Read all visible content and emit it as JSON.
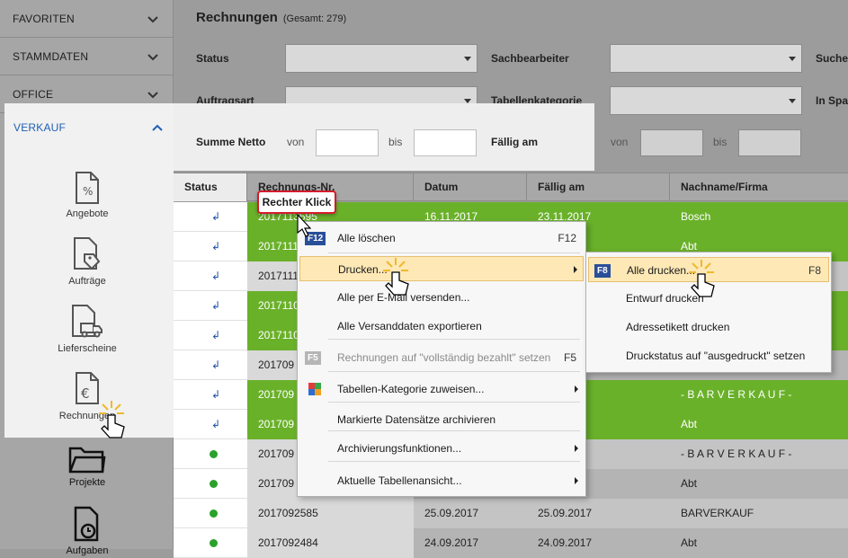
{
  "sidebar": {
    "sections": [
      "FAVORITEN",
      "STAMMDATEN",
      "OFFICE"
    ],
    "active_section": "VERKAUF",
    "items": [
      {
        "label": "Angebote",
        "icon": "offer-document-icon"
      },
      {
        "label": "Aufträge",
        "icon": "order-tag-icon"
      },
      {
        "label": "Lieferscheine",
        "icon": "delivery-truck-icon"
      },
      {
        "label": "Rechnungen",
        "icon": "invoice-euro-icon"
      },
      {
        "label": "Projekte",
        "icon": "project-folder-icon"
      },
      {
        "label": "Aufgaben",
        "icon": "task-clock-icon"
      }
    ]
  },
  "header": {
    "title": "Rechnungen",
    "count": "(Gesamt: 279)"
  },
  "filters": {
    "status": "Status",
    "sachbearbeiter": "Sachbearbeiter",
    "suche": "Suche",
    "auftragsart": "Auftragsart",
    "tabellenkategorie": "Tabellenkategorie",
    "inspa": "In Spa",
    "summe_netto": "Summe Netto",
    "von": "von",
    "bis": "bis",
    "faellig_am": "Fällig am"
  },
  "table": {
    "columns": [
      "Status",
      "Rechnungs-Nr.",
      "Datum",
      "Fällig am",
      "Nachname/Firma"
    ],
    "rows": [
      {
        "status": "return",
        "nr": "2017113595",
        "datum": "16.11.2017",
        "faellig": "23.11.2017",
        "name": "Bosch",
        "green": true
      },
      {
        "status": "return",
        "nr": "2017111",
        "datum": "",
        "faellig": "",
        "name": "Abt",
        "green": true
      },
      {
        "status": "return",
        "nr": "2017111",
        "datum": "",
        "faellig": "",
        "name": "",
        "green": false
      },
      {
        "status": "return",
        "nr": "2017110",
        "datum": "",
        "faellig": "",
        "name": "",
        "green": true
      },
      {
        "status": "return",
        "nr": "2017110",
        "datum": "",
        "faellig": "",
        "name": "",
        "green": true
      },
      {
        "status": "return",
        "nr": "201709",
        "datum": "",
        "faellig": "",
        "name": "",
        "green": false
      },
      {
        "status": "return",
        "nr": "201709",
        "datum": "",
        "faellig": "",
        "name": "- B A R V E R K A U F -",
        "green": true
      },
      {
        "status": "return",
        "nr": "201709",
        "datum": "",
        "faellig": "",
        "name": "Abt",
        "green": true
      },
      {
        "status": "paid",
        "nr": "201709",
        "datum": "",
        "faellig": "",
        "name": "- B A R V E R K A U F -",
        "green": false
      },
      {
        "status": "paid",
        "nr": "201709",
        "datum": "",
        "faellig": "",
        "name": "Abt",
        "green": false
      },
      {
        "status": "paid",
        "nr": "2017092585",
        "datum": "25.09.2017",
        "faellig": "25.09.2017",
        "name": "BARVERKAUF",
        "green": false
      },
      {
        "status": "paid",
        "nr": "2017092484",
        "datum": "24.09.2017",
        "faellig": "24.09.2017",
        "name": "Abt",
        "green": false
      }
    ]
  },
  "context_menu": {
    "items": [
      {
        "label": "Alle löschen",
        "shortcut": "F12",
        "key": "F12",
        "disabled": false,
        "sub": false
      },
      {
        "label": "Drucken...",
        "shortcut": "",
        "key": "",
        "disabled": false,
        "sub": true,
        "highlight": true
      },
      {
        "label": "Alle per E-Mail versenden...",
        "shortcut": "",
        "key": "",
        "disabled": false,
        "sub": false
      },
      {
        "label": "Alle Versanddaten exportieren",
        "shortcut": "",
        "key": "",
        "disabled": false,
        "sub": false
      },
      {
        "label": "Rechnungen auf \"vollständig bezahlt\" setzen",
        "shortcut": "F5",
        "key": "F5",
        "disabled": true,
        "sub": false
      },
      {
        "label": "Tabellen-Kategorie zuweisen...",
        "shortcut": "",
        "key": "",
        "disabled": false,
        "sub": true
      },
      {
        "label": "Markierte Datensätze archivieren",
        "shortcut": "",
        "key": "",
        "disabled": false,
        "sub": false
      },
      {
        "label": "Archivierungsfunktionen...",
        "shortcut": "",
        "key": "",
        "disabled": false,
        "sub": true
      },
      {
        "label": "Aktuelle Tabellenansicht...",
        "shortcut": "",
        "key": "",
        "disabled": false,
        "sub": true
      }
    ]
  },
  "submenu": {
    "items": [
      {
        "label": "Alle drucken...",
        "shortcut": "F8",
        "key": "F8",
        "highlight": true
      },
      {
        "label": "Entwurf drucken",
        "shortcut": "",
        "key": ""
      },
      {
        "label": "Adressetikett drucken",
        "shortcut": "",
        "key": ""
      },
      {
        "label": "Druckstatus auf \"ausgedruckt\" setzen",
        "shortcut": "",
        "key": ""
      }
    ]
  },
  "tooltip": "Rechter Klick",
  "colors": {
    "green_row": "#6ab12a",
    "highlight_row": "#fde8b6",
    "accent": "#1e5fb6",
    "badge": "#2a4f99"
  }
}
